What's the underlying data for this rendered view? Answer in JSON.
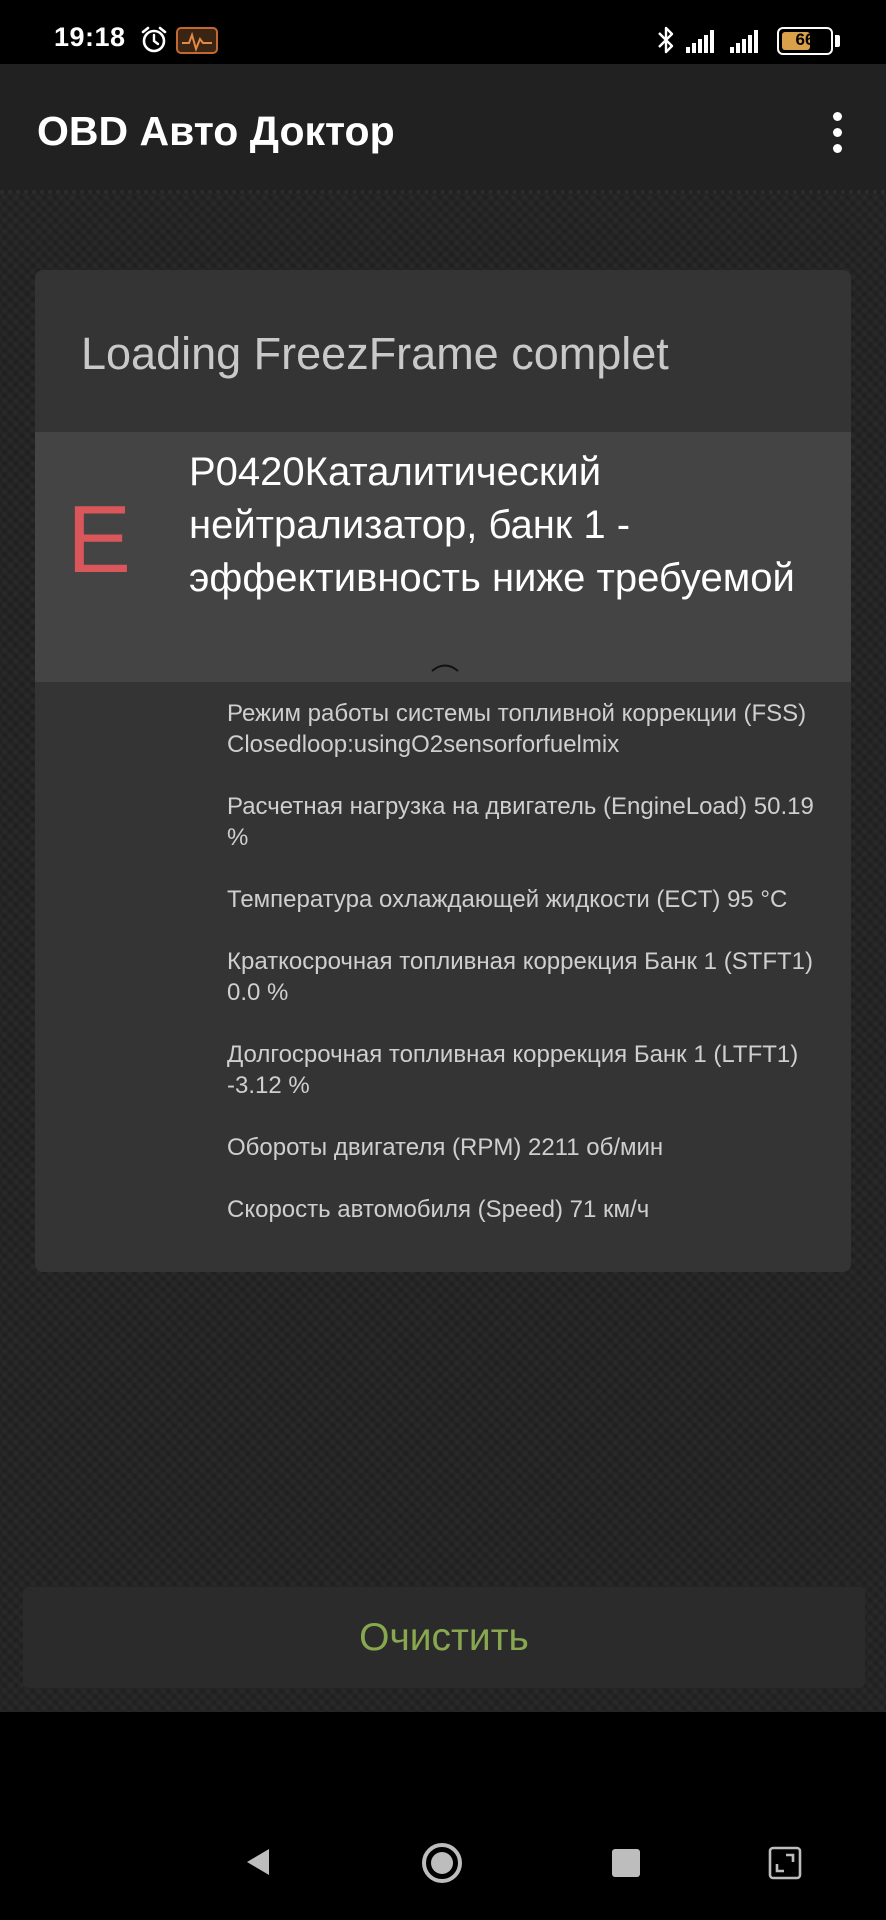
{
  "status_bar": {
    "time": "19:18",
    "battery_level": "66",
    "battery_fraction": 0.66,
    "icons": [
      "alarm-icon",
      "obd-car-icon",
      "bluetooth-icon",
      "signal-icon",
      "signal-icon",
      "battery-icon"
    ]
  },
  "app_bar": {
    "title": "OBD Авто Доктор",
    "menu_icon": "overflow-menu-icon"
  },
  "dialog": {
    "title": "Loading FreezFrame complet",
    "dtc": {
      "letter": "E",
      "description": "P0420Каталитический нейтрализатор, банк 1 - эффективность ниже требуемой",
      "letter_color": "#d9575a",
      "toggle_icon": "chevron-up-icon"
    },
    "parameters": [
      "Режим работы системы топливной коррекции (FSS) Closedloop:usingO2sensorforfuelmix",
      "Расчетная нагрузка на двигатель (EngineLoad) 50.19 %",
      "Температура охлаждающей жидкости (ECT) 95 °C",
      "Краткосрочная топливная коррекция Банк 1 (STFT1) 0.0 %",
      "Долгосрочная топливная коррекция Банк 1 (LTFT1) -3.12 %",
      "Обороты двигателя (RPM) 2211 об/мин",
      "Скорость автомобиля (Speed) 71 км/ч"
    ]
  },
  "actions": {
    "clear_label": "Очистить",
    "clear_color": "#88a84f"
  },
  "nav_bar": {
    "icons": [
      "back-icon",
      "home-icon",
      "recents-icon",
      "fullscreen-icon"
    ]
  }
}
